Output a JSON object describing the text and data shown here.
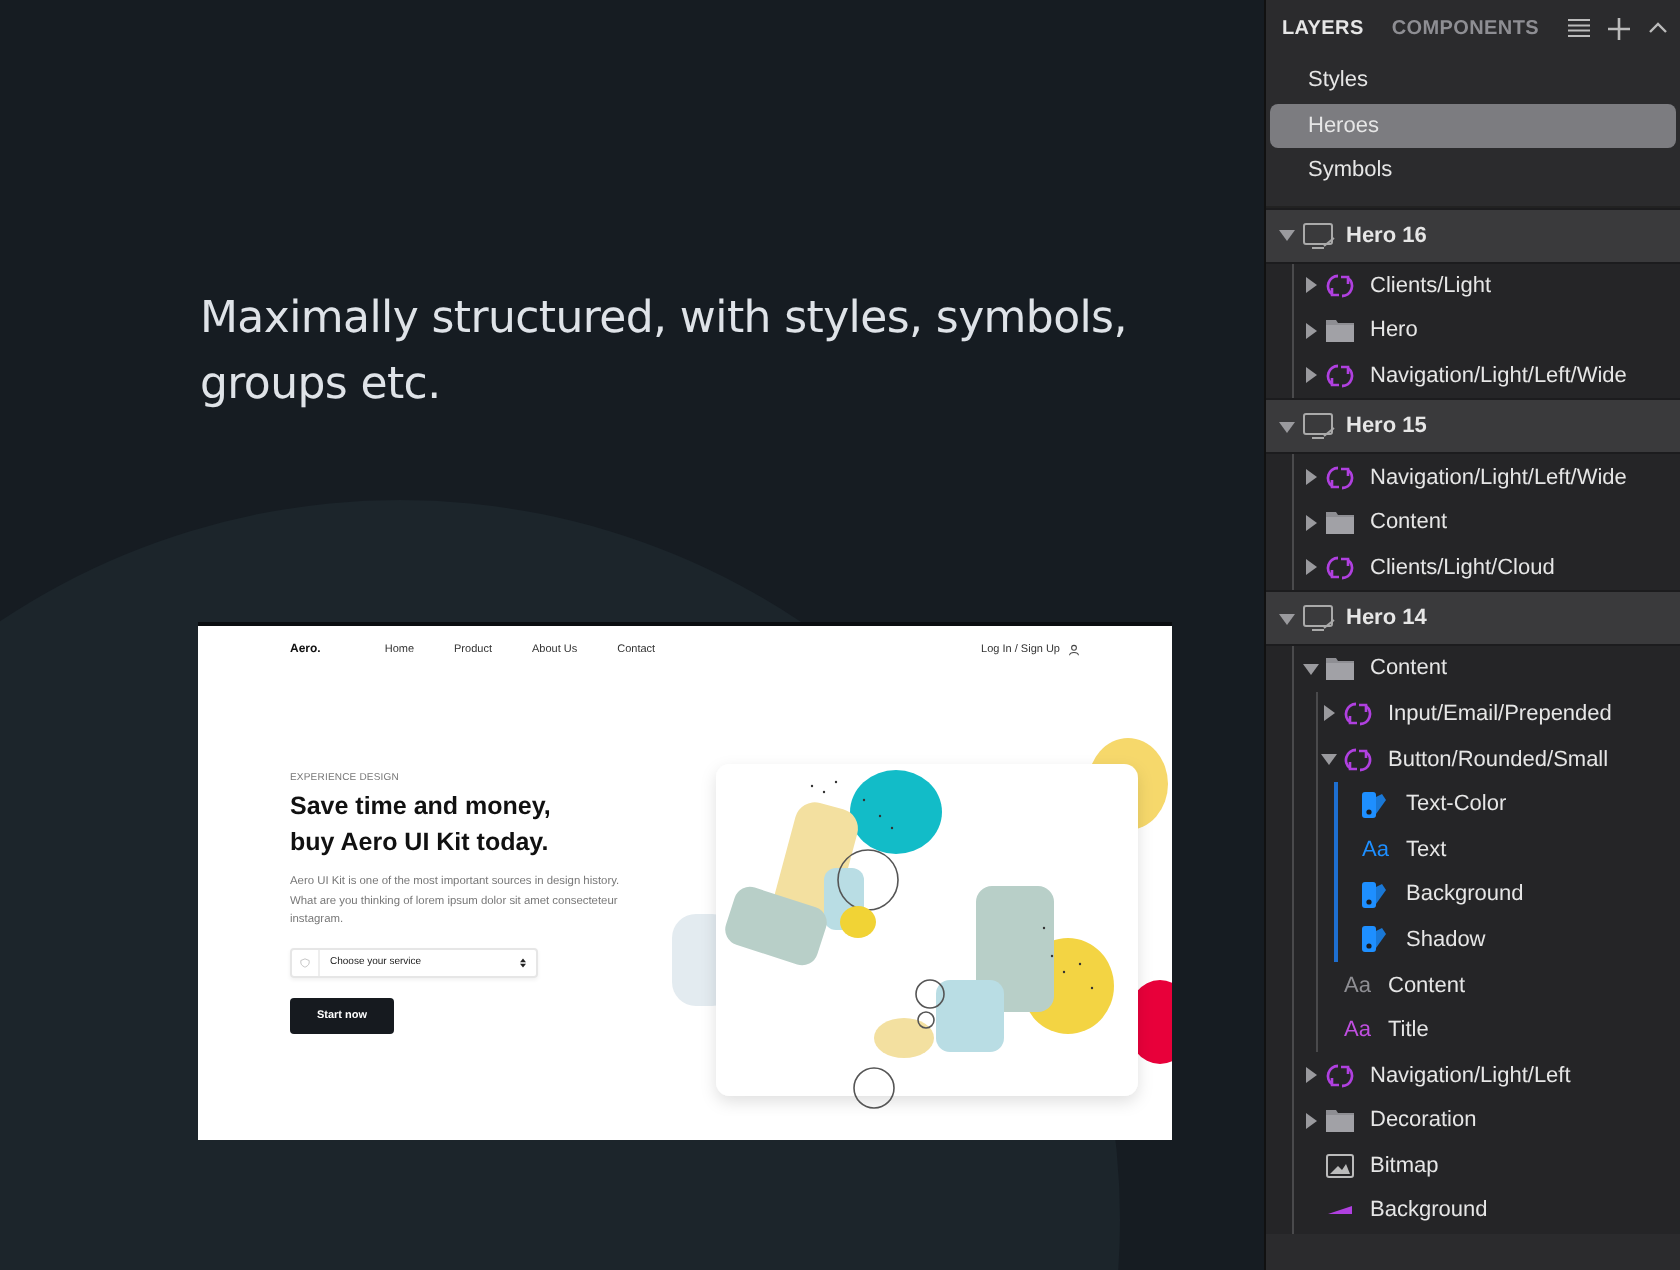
{
  "headline": "Maximally structured, with styles, symbols, groups etc.",
  "preview": {
    "logo": "Aero.",
    "nav": [
      "Home",
      "Product",
      "About Us",
      "Contact"
    ],
    "login": "Log In / Sign Up",
    "eyebrow": "EXPERIENCE DESIGN",
    "title_lines": [
      "Save time and money,",
      "buy Aero UI Kit today."
    ],
    "paragraph": "Aero UI Kit is one of the most important sources in design history. What are you thinking of lorem ipsum dolor sit amet consecteteur instagram.",
    "select": {
      "value": "Choose your service"
    },
    "button": "Start now"
  },
  "panel": {
    "tabs": [
      {
        "label": "LAYERS",
        "selected": true
      },
      {
        "label": "COMPONENTS",
        "selected": false
      }
    ],
    "pages": [
      {
        "label": "Styles",
        "selected": false
      },
      {
        "label": "Heroes",
        "selected": true
      },
      {
        "label": "Symbols",
        "selected": false
      }
    ],
    "layers": [
      {
        "name": "Hero 16",
        "kind": "artboard",
        "expanded": true,
        "children": [
          {
            "name": "Clients/Light",
            "kind": "symbol",
            "expanded": false
          },
          {
            "name": "Hero",
            "kind": "folder",
            "expanded": false
          },
          {
            "name": "Navigation/Light/Left/Wide",
            "kind": "symbol",
            "expanded": false
          }
        ]
      },
      {
        "name": "Hero 15",
        "kind": "artboard",
        "expanded": true,
        "children": [
          {
            "name": "Navigation/Light/Left/Wide",
            "kind": "symbol",
            "expanded": false
          },
          {
            "name": "Content",
            "kind": "folder",
            "expanded": false
          },
          {
            "name": "Clients/Light/Cloud",
            "kind": "symbol",
            "expanded": false
          }
        ]
      },
      {
        "name": "Hero 14",
        "kind": "artboard",
        "expanded": true,
        "children": [
          {
            "name": "Content",
            "kind": "folder",
            "expanded": true,
            "children": [
              {
                "name": "Input/Email/Prepended",
                "kind": "symbol",
                "expanded": false
              },
              {
                "name": "Button/Rounded/Small",
                "kind": "symbol",
                "expanded": true,
                "children": [
                  {
                    "name": "Text-Color",
                    "kind": "style"
                  },
                  {
                    "name": "Text",
                    "kind": "text",
                    "glyph": "Aa",
                    "color": "#1e8fff"
                  },
                  {
                    "name": "Background",
                    "kind": "style"
                  },
                  {
                    "name": "Shadow",
                    "kind": "style"
                  }
                ]
              },
              {
                "name": "Content",
                "kind": "text",
                "glyph": "Aa",
                "color": "#8e8e93"
              },
              {
                "name": "Title",
                "kind": "text",
                "glyph": "Aa",
                "color": "#c04fe0"
              }
            ]
          },
          {
            "name": "Navigation/Light/Left",
            "kind": "symbol",
            "expanded": false
          },
          {
            "name": "Decoration",
            "kind": "folder",
            "expanded": false
          },
          {
            "name": "Bitmap",
            "kind": "image"
          },
          {
            "name": "Background",
            "kind": "shape"
          }
        ]
      }
    ]
  }
}
